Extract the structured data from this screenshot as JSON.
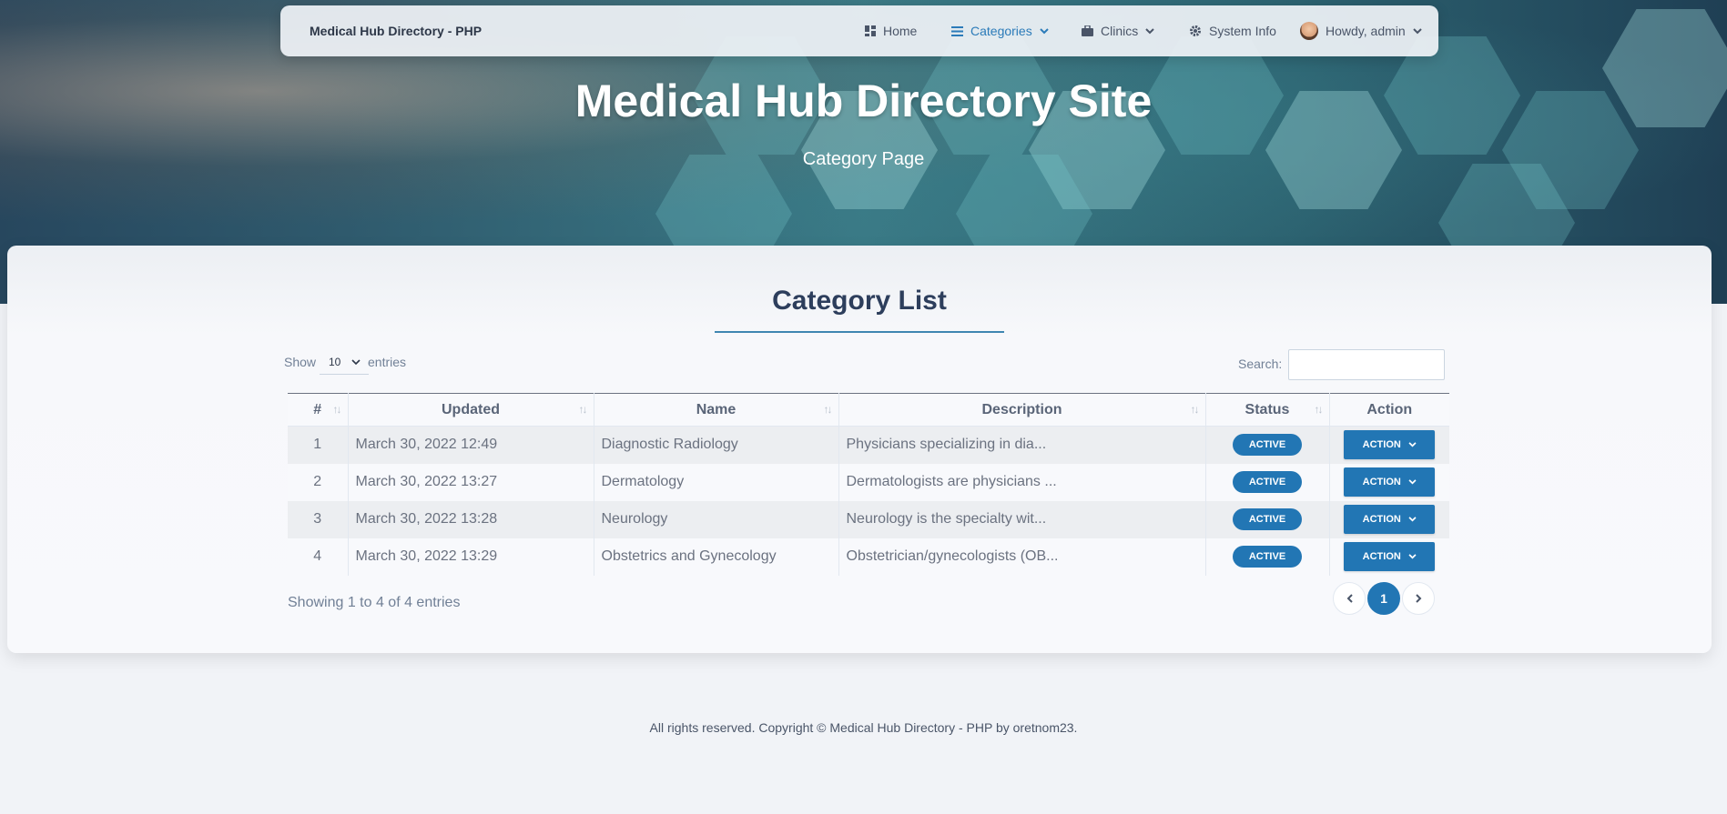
{
  "navbar": {
    "brand": "Medical Hub Directory - PHP",
    "items": [
      {
        "label": "Home",
        "icon": "dashboard-icon"
      },
      {
        "label": "Categories",
        "icon": "list-icon",
        "active": true
      },
      {
        "label": "Clinics",
        "icon": "briefcase-icon"
      },
      {
        "label": "System Info",
        "icon": "gear-icon"
      },
      {
        "label": "Howdy, admin",
        "icon": "avatar"
      }
    ]
  },
  "hero": {
    "title": "Medical Hub Directory Site",
    "subtitle": "Category Page"
  },
  "card": {
    "title": "Category List",
    "show_label": "Show",
    "entries_label": "entries",
    "page_length": "10",
    "search_label": "Search:",
    "search_value": ""
  },
  "table": {
    "columns": [
      "#",
      "Updated",
      "Name",
      "Description",
      "Status",
      "Action"
    ],
    "rows": [
      {
        "num": "1",
        "updated": "March 30, 2022 12:49",
        "name": "Diagnostic Radiology",
        "description": "Physicians specializing in dia...",
        "status": "ACTIVE",
        "action": "ACTION"
      },
      {
        "num": "2",
        "updated": "March 30, 2022 13:27",
        "name": "Dermatology",
        "description": "Dermatologists are physicians ...",
        "status": "ACTIVE",
        "action": "ACTION"
      },
      {
        "num": "3",
        "updated": "March 30, 2022 13:28",
        "name": "Neurology",
        "description": "Neurology is the specialty wit...",
        "status": "ACTIVE",
        "action": "ACTION"
      },
      {
        "num": "4",
        "updated": "March 30, 2022 13:29",
        "name": "Obstetrics and Gynecology",
        "description": "Obstetrician/gynecologists (OB...",
        "status": "ACTIVE",
        "action": "ACTION"
      }
    ]
  },
  "pagination": {
    "info": "Showing 1 to 4 of 4 entries",
    "current_page": "1"
  },
  "footer": {
    "text": "All rights reserved. Copyright © Medical Hub Directory - PHP by oretnom23."
  },
  "colors": {
    "primary": "#2276b4",
    "title": "#2d3e5c",
    "active_nav": "#2b7bb9"
  }
}
